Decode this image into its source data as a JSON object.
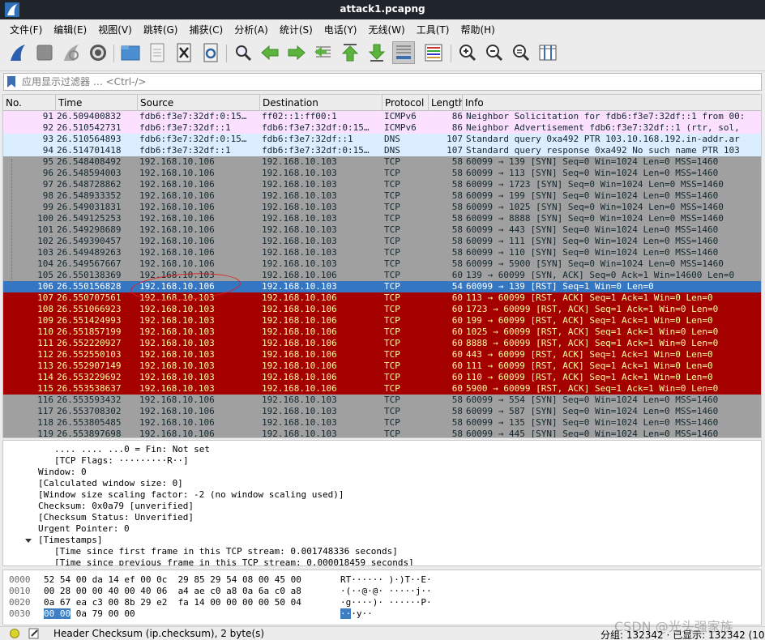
{
  "window": {
    "title": "attack1.pcapng"
  },
  "menu": [
    "文件(F)",
    "编辑(E)",
    "视图(V)",
    "跳转(G)",
    "捕获(C)",
    "分析(A)",
    "统计(S)",
    "电话(Y)",
    "无线(W)",
    "工具(T)",
    "帮助(H)"
  ],
  "toolbar": {
    "icons": [
      "shark-fin-start-icon",
      "stop-capture-icon",
      "restart-capture-icon",
      "capture-options-icon",
      "open-file-icon",
      "file-icon",
      "close-file-icon",
      "reload-icon",
      "find-packet-icon",
      "go-back-icon",
      "go-forward-icon",
      "go-to-packet-icon",
      "go-first-icon",
      "go-last-icon",
      "auto-scroll-icon",
      "colorize-icon",
      "zoom-in-icon",
      "zoom-out-icon",
      "normal-size-icon",
      "resize-columns-icon"
    ]
  },
  "filter": {
    "placeholder": "应用显示过滤器 … <Ctrl-/>"
  },
  "columns": {
    "no": "No.",
    "time": "Time",
    "source": "Source",
    "destination": "Destination",
    "protocol": "Protocol",
    "length": "Length",
    "info": "Info"
  },
  "colors": {
    "icmpv6": "#fce0ff",
    "dns": "#daeeff",
    "tcp_gray": "#a0a0a0",
    "tcp_rst": "#a40000",
    "selected": "#3476c2",
    "rst_text": "#fffc9c"
  },
  "packets": [
    {
      "no": "91",
      "time": "26.509400832",
      "source": "fdb6:f3e7:32df:0:15…",
      "destination": "ff02::1:ff00:1",
      "protocol": "ICMPv6",
      "length": "86",
      "info": "Neighbor Solicitation for fdb6:f3e7:32df::1 from 00:",
      "style": "icmpv6"
    },
    {
      "no": "92",
      "time": "26.510542731",
      "source": "fdb6:f3e7:32df::1",
      "destination": "fdb6:f3e7:32df:0:15…",
      "protocol": "ICMPv6",
      "length": "86",
      "info": "Neighbor Advertisement fdb6:f3e7:32df::1 (rtr, sol,",
      "style": "icmpv6"
    },
    {
      "no": "93",
      "time": "26.510564893",
      "source": "fdb6:f3e7:32df:0:15…",
      "destination": "fdb6:f3e7:32df::1",
      "protocol": "DNS",
      "length": "107",
      "info": "Standard query 0xa492 PTR 103.10.168.192.in-addr.ar",
      "style": "dns"
    },
    {
      "no": "94",
      "time": "26.514701418",
      "source": "fdb6:f3e7:32df::1",
      "destination": "fdb6:f3e7:32df:0:15…",
      "protocol": "DNS",
      "length": "107",
      "info": "Standard query response 0xa492 No such name PTR 103",
      "style": "dns"
    },
    {
      "no": "95",
      "time": "26.548408492",
      "source": "192.168.10.106",
      "destination": "192.168.10.103",
      "protocol": "TCP",
      "length": "58",
      "info": "60099 → 139 [SYN] Seq=0 Win=1024 Len=0 MSS=1460",
      "style": "tcp"
    },
    {
      "no": "96",
      "time": "26.548594003",
      "source": "192.168.10.106",
      "destination": "192.168.10.103",
      "protocol": "TCP",
      "length": "58",
      "info": "60099 → 113 [SYN] Seq=0 Win=1024 Len=0 MSS=1460",
      "style": "tcp"
    },
    {
      "no": "97",
      "time": "26.548728862",
      "source": "192.168.10.106",
      "destination": "192.168.10.103",
      "protocol": "TCP",
      "length": "58",
      "info": "60099 → 1723 [SYN] Seq=0 Win=1024 Len=0 MSS=1460",
      "style": "tcp"
    },
    {
      "no": "98",
      "time": "26.548933352",
      "source": "192.168.10.106",
      "destination": "192.168.10.103",
      "protocol": "TCP",
      "length": "58",
      "info": "60099 → 199 [SYN] Seq=0 Win=1024 Len=0 MSS=1460",
      "style": "tcp"
    },
    {
      "no": "99",
      "time": "26.549031831",
      "source": "192.168.10.106",
      "destination": "192.168.10.103",
      "protocol": "TCP",
      "length": "58",
      "info": "60099 → 1025 [SYN] Seq=0 Win=1024 Len=0 MSS=1460",
      "style": "tcp"
    },
    {
      "no": "100",
      "time": "26.549125253",
      "source": "192.168.10.106",
      "destination": "192.168.10.103",
      "protocol": "TCP",
      "length": "58",
      "info": "60099 → 8888 [SYN] Seq=0 Win=1024 Len=0 MSS=1460",
      "style": "tcp"
    },
    {
      "no": "101",
      "time": "26.549298689",
      "source": "192.168.10.106",
      "destination": "192.168.10.103",
      "protocol": "TCP",
      "length": "58",
      "info": "60099 → 443 [SYN] Seq=0 Win=1024 Len=0 MSS=1460",
      "style": "tcp"
    },
    {
      "no": "102",
      "time": "26.549390457",
      "source": "192.168.10.106",
      "destination": "192.168.10.103",
      "protocol": "TCP",
      "length": "58",
      "info": "60099 → 111 [SYN] Seq=0 Win=1024 Len=0 MSS=1460",
      "style": "tcp"
    },
    {
      "no": "103",
      "time": "26.549489263",
      "source": "192.168.10.106",
      "destination": "192.168.10.103",
      "protocol": "TCP",
      "length": "58",
      "info": "60099 → 110 [SYN] Seq=0 Win=1024 Len=0 MSS=1460",
      "style": "tcp"
    },
    {
      "no": "104",
      "time": "26.549567667",
      "source": "192.168.10.106",
      "destination": "192.168.10.103",
      "protocol": "TCP",
      "length": "58",
      "info": "60099 → 5900 [SYN] Seq=0 Win=1024 Len=0 MSS=1460",
      "style": "tcp"
    },
    {
      "no": "105",
      "time": "26.550138369",
      "source": "192.168.10.103",
      "destination": "192.168.10.106",
      "protocol": "TCP",
      "length": "60",
      "info": "139 → 60099 [SYN, ACK] Seq=0 Ack=1 Win=14600 Len=0",
      "style": "tcp"
    },
    {
      "no": "106",
      "time": "26.550156828",
      "source": "192.168.10.106",
      "destination": "192.168.10.103",
      "protocol": "TCP",
      "length": "54",
      "info": "60099 → 139 [RST] Seq=1 Win=0 Len=0",
      "style": "selected"
    },
    {
      "no": "107",
      "time": "26.550707561",
      "source": "192.168.10.103",
      "destination": "192.168.10.106",
      "protocol": "TCP",
      "length": "60",
      "info": "113 → 60099 [RST, ACK] Seq=1 Ack=1 Win=0 Len=0",
      "style": "rst"
    },
    {
      "no": "108",
      "time": "26.551066923",
      "source": "192.168.10.103",
      "destination": "192.168.10.106",
      "protocol": "TCP",
      "length": "60",
      "info": "1723 → 60099 [RST, ACK] Seq=1 Ack=1 Win=0 Len=0",
      "style": "rst"
    },
    {
      "no": "109",
      "time": "26.551424993",
      "source": "192.168.10.103",
      "destination": "192.168.10.106",
      "protocol": "TCP",
      "length": "60",
      "info": "199 → 60099 [RST, ACK] Seq=1 Ack=1 Win=0 Len=0",
      "style": "rst"
    },
    {
      "no": "110",
      "time": "26.551857199",
      "source": "192.168.10.103",
      "destination": "192.168.10.106",
      "protocol": "TCP",
      "length": "60",
      "info": "1025 → 60099 [RST, ACK] Seq=1 Ack=1 Win=0 Len=0",
      "style": "rst"
    },
    {
      "no": "111",
      "time": "26.552220927",
      "source": "192.168.10.103",
      "destination": "192.168.10.106",
      "protocol": "TCP",
      "length": "60",
      "info": "8888 → 60099 [RST, ACK] Seq=1 Ack=1 Win=0 Len=0",
      "style": "rst"
    },
    {
      "no": "112",
      "time": "26.552550103",
      "source": "192.168.10.103",
      "destination": "192.168.10.106",
      "protocol": "TCP",
      "length": "60",
      "info": "443 → 60099 [RST, ACK] Seq=1 Ack=1 Win=0 Len=0",
      "style": "rst"
    },
    {
      "no": "113",
      "time": "26.552907149",
      "source": "192.168.10.103",
      "destination": "192.168.10.106",
      "protocol": "TCP",
      "length": "60",
      "info": "111 → 60099 [RST, ACK] Seq=1 Ack=1 Win=0 Len=0",
      "style": "rst"
    },
    {
      "no": "114",
      "time": "26.553229692",
      "source": "192.168.10.103",
      "destination": "192.168.10.106",
      "protocol": "TCP",
      "length": "60",
      "info": "110 → 60099 [RST, ACK] Seq=1 Ack=1 Win=0 Len=0",
      "style": "rst"
    },
    {
      "no": "115",
      "time": "26.553538637",
      "source": "192.168.10.103",
      "destination": "192.168.10.106",
      "protocol": "TCP",
      "length": "60",
      "info": "5900 → 60099 [RST, ACK] Seq=1 Ack=1 Win=0 Len=0",
      "style": "rst"
    },
    {
      "no": "116",
      "time": "26.553593432",
      "source": "192.168.10.106",
      "destination": "192.168.10.103",
      "protocol": "TCP",
      "length": "58",
      "info": "60099 → 554 [SYN] Seq=0 Win=1024 Len=0 MSS=1460",
      "style": "tcp"
    },
    {
      "no": "117",
      "time": "26.553708302",
      "source": "192.168.10.106",
      "destination": "192.168.10.103",
      "protocol": "TCP",
      "length": "58",
      "info": "60099 → 587 [SYN] Seq=0 Win=1024 Len=0 MSS=1460",
      "style": "tcp"
    },
    {
      "no": "118",
      "time": "26.553805485",
      "source": "192.168.10.106",
      "destination": "192.168.10.103",
      "protocol": "TCP",
      "length": "58",
      "info": "60099 → 135 [SYN] Seq=0 Win=1024 Len=0 MSS=1460",
      "style": "tcp"
    },
    {
      "no": "119",
      "time": "26.553897698",
      "source": "192.168.10.106",
      "destination": "192.168.10.103",
      "protocol": "TCP",
      "length": "58",
      "info": "60099 → 445 [SYN] Seq=0 Win=1024 Len=0 MSS=1460",
      "style": "tcp"
    }
  ],
  "details": [
    {
      "text": ".... .... ...0 = Fin: Not set",
      "indent": 3,
      "expander": ""
    },
    {
      "text": "[TCP Flags: ·········R··]",
      "indent": 3,
      "expander": ""
    },
    {
      "text": "Window: 0",
      "indent": 2,
      "expander": ""
    },
    {
      "text": "[Calculated window size: 0]",
      "indent": 2,
      "expander": ""
    },
    {
      "text": "[Window size scaling factor: -2 (no window scaling used)]",
      "indent": 2,
      "expander": ""
    },
    {
      "text": "Checksum: 0x0a79 [unverified]",
      "indent": 2,
      "expander": ""
    },
    {
      "text": "[Checksum Status: Unverified]",
      "indent": 2,
      "expander": ""
    },
    {
      "text": "Urgent Pointer: 0",
      "indent": 2,
      "expander": ""
    },
    {
      "text": "[Timestamps]",
      "indent": 2,
      "expander": "down"
    },
    {
      "text": "[Time since first frame in this TCP stream: 0.001748336 seconds]",
      "indent": 3,
      "expander": ""
    },
    {
      "text": "[Time since previous frame in this TCP stream: 0.000018459 seconds]",
      "indent": 3,
      "expander": ""
    }
  ],
  "bytes": [
    {
      "offset": "0000",
      "hex_pre": "",
      "hex_hl": "",
      "hex_post": "52 54 00 da 14 ef 00 0c  29 85 29 54 08 00 45 00",
      "asc_pre": "",
      "asc_hl": "",
      "asc_post": "RT······ )·)T··E·"
    },
    {
      "offset": "0010",
      "hex_pre": "",
      "hex_hl": "",
      "hex_post": "00 28 00 00 40 00 40 06  a4 ae c0 a8 0a 6a c0 a8",
      "asc_pre": "",
      "asc_hl": "",
      "asc_post": "·(··@·@· ·····j··"
    },
    {
      "offset": "0020",
      "hex_pre": "",
      "hex_hl": "",
      "hex_post": "0a 67 ea c3 00 8b 29 e2  fa 14 00 00 00 00 50 04",
      "asc_pre": "",
      "asc_hl": "",
      "asc_post": "·g····)· ······P·"
    },
    {
      "offset": "0030",
      "hex_pre": "",
      "hex_hl": "00 00",
      "hex_post": " 0a 79 00 00",
      "asc_pre": "",
      "asc_hl": "··",
      "asc_post": "·y··"
    }
  ],
  "status": {
    "field": "Header Checksum (ip.checksum), 2 byte(s)",
    "counts": "分组: 132342 · 已显示: 132342 (10"
  },
  "watermark": "CSDN @光头强家族"
}
